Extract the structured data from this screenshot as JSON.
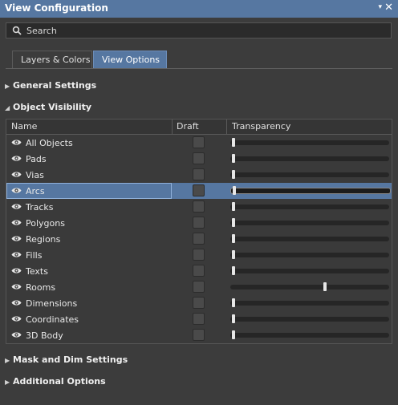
{
  "panel": {
    "title": "View Configuration",
    "pin_glyph": "▾",
    "close_glyph": "✕"
  },
  "search": {
    "placeholder": "Search"
  },
  "tabs": [
    {
      "label": "Layers & Colors",
      "active": false
    },
    {
      "label": "View Options",
      "active": true
    }
  ],
  "sections": {
    "general": "General Settings",
    "visibility": "Object Visibility",
    "mask": "Mask and Dim Settings",
    "additional": "Additional Options"
  },
  "table": {
    "columns": [
      "Name",
      "Draft",
      "Transparency"
    ],
    "rows": [
      {
        "name": "All Objects",
        "transparency": 0.0,
        "selected": false
      },
      {
        "name": "Pads",
        "transparency": 0.0,
        "selected": false
      },
      {
        "name": "Vias",
        "transparency": 0.0,
        "selected": false
      },
      {
        "name": "Arcs",
        "transparency": 0.0,
        "selected": true
      },
      {
        "name": "Tracks",
        "transparency": 0.0,
        "selected": false
      },
      {
        "name": "Polygons",
        "transparency": 0.0,
        "selected": false
      },
      {
        "name": "Regions",
        "transparency": 0.0,
        "selected": false
      },
      {
        "name": "Fills",
        "transparency": 0.0,
        "selected": false
      },
      {
        "name": "Texts",
        "transparency": 0.0,
        "selected": false
      },
      {
        "name": "Rooms",
        "transparency": 0.6,
        "selected": false
      },
      {
        "name": "Dimensions",
        "transparency": 0.0,
        "selected": false
      },
      {
        "name": "Coordinates",
        "transparency": 0.0,
        "selected": false
      },
      {
        "name": "3D Body",
        "transparency": 0.0,
        "selected": false
      }
    ]
  },
  "colors": {
    "accent": "#5677a1",
    "background": "#3c3c3c"
  }
}
